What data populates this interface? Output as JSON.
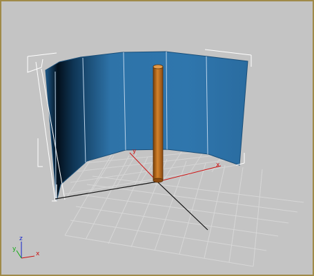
{
  "viewport": {
    "background": "#c4c4c4",
    "frame_color": "#a08a48"
  },
  "gizmo": {
    "x_label": "x",
    "y_label": "y",
    "z_label": "z",
    "x_color": "#cc1111",
    "y_color": "#11aa11",
    "z_color": "#1122cc"
  },
  "pivot_axes": {
    "x_label": "x",
    "y_label": "y",
    "color": "#cc1111"
  },
  "objects": {
    "wall_color": "#2e73a8",
    "cylinder_color": "#b86a18",
    "selection_color": "#ffffff",
    "grid_color": "#d7d7d7"
  }
}
